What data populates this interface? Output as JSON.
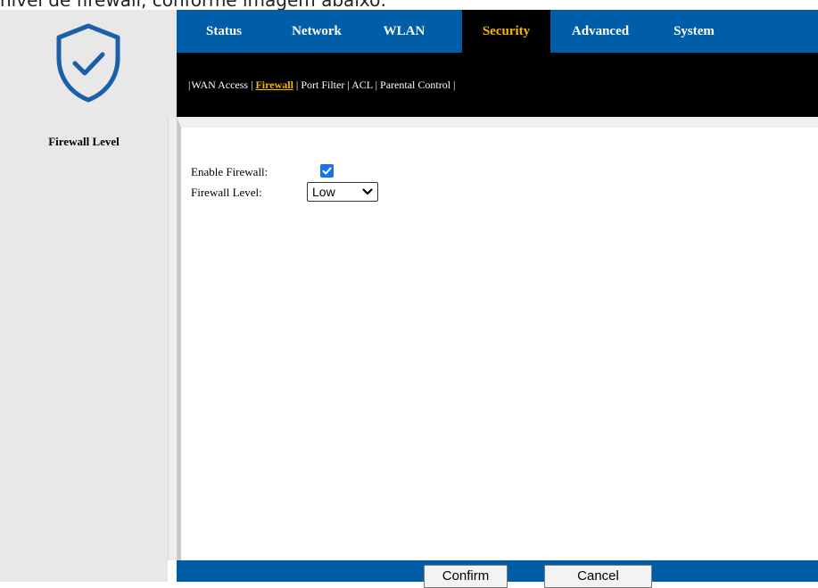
{
  "caption": "nível de firewall, conforme imagem abaixo:",
  "nav": {
    "tabs": [
      {
        "label": "Status"
      },
      {
        "label": "Network"
      },
      {
        "label": "WLAN"
      },
      {
        "label": "Security",
        "active": true
      },
      {
        "label": "Advanced"
      },
      {
        "label": "System"
      }
    ]
  },
  "subnav": {
    "links": [
      "WAN Access",
      "Firewall",
      "Port Filter",
      "ACL",
      "Parental Control"
    ],
    "active": "Firewall"
  },
  "sidebar": {
    "items": [
      {
        "label": "Firewall Level"
      }
    ]
  },
  "form": {
    "enable_label": "Enable Firewall:",
    "enable_checked": true,
    "level_label": "Firewall Level:",
    "level_value": "Low"
  },
  "buttons": {
    "confirm": "Confirm",
    "cancel": "Cancel"
  },
  "colors": {
    "brand_blue": "#005da8",
    "active_tab": "#f5b700",
    "logo_blue": "#1a5fa8",
    "checkbox_blue": "#1a73e8"
  },
  "icons": {
    "logo": "shield-check-icon",
    "checkbox": "check-icon",
    "select": "chevron-down-icon"
  }
}
